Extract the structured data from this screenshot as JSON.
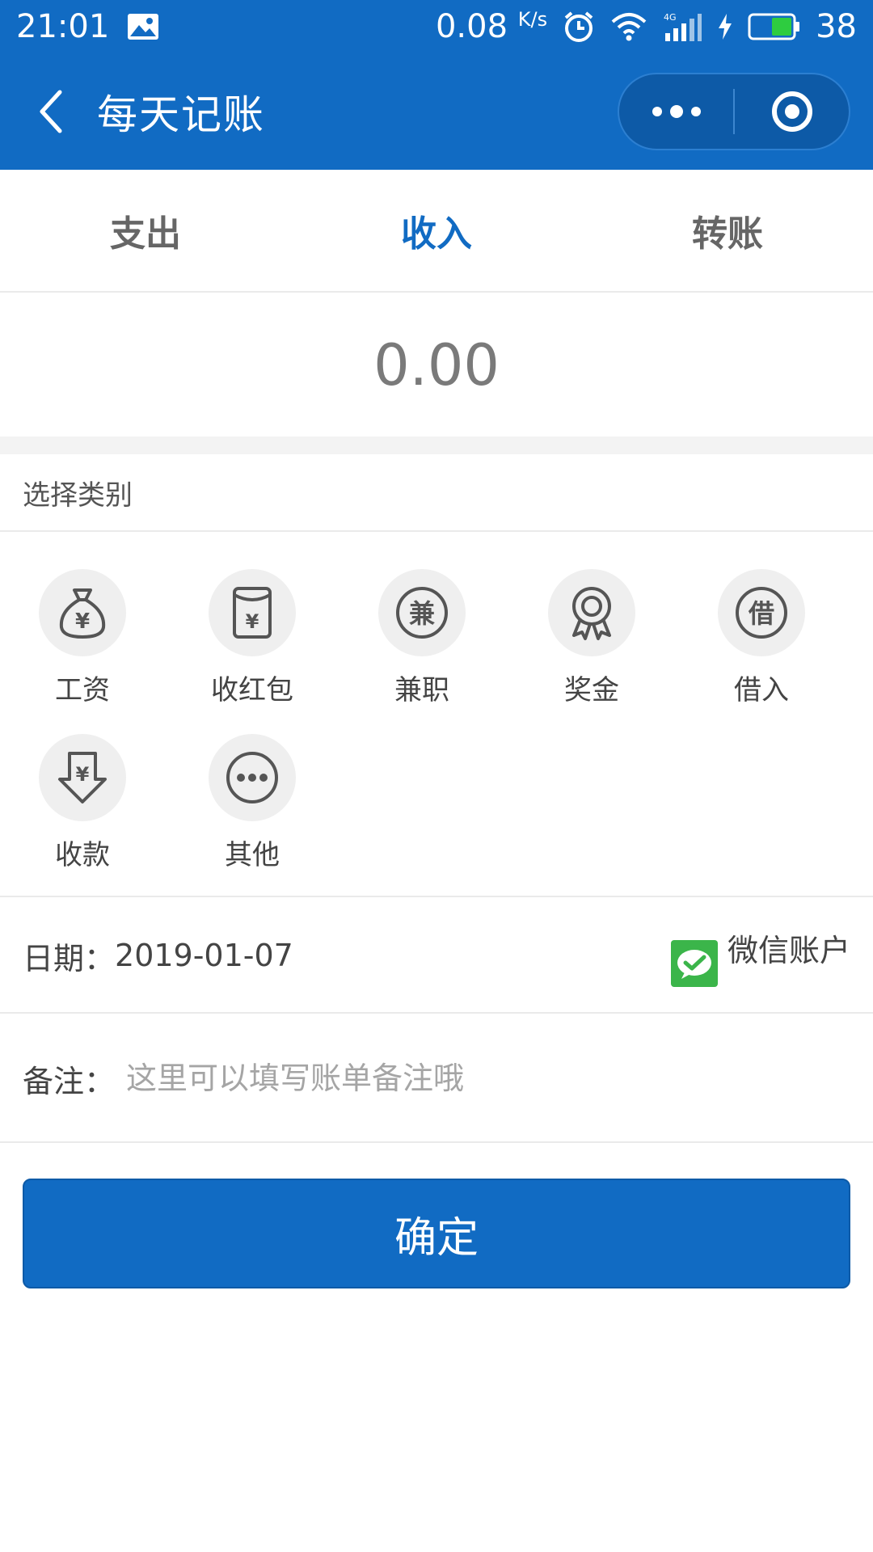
{
  "status_bar": {
    "time": "21:01",
    "net_speed": "0.08",
    "net_unit": "K/s",
    "battery": "38"
  },
  "nav": {
    "title": "每天记账"
  },
  "tabs": [
    {
      "label": "支出",
      "active": false
    },
    {
      "label": "收入",
      "active": true
    },
    {
      "label": "转账",
      "active": false
    }
  ],
  "amount": "0.00",
  "category": {
    "header": "选择类别",
    "items": [
      {
        "label": "工资",
        "icon": "money-bag-icon"
      },
      {
        "label": "收红包",
        "icon": "red-envelope-icon"
      },
      {
        "label": "兼职",
        "icon": "part-time-icon"
      },
      {
        "label": "奖金",
        "icon": "medal-icon"
      },
      {
        "label": "借入",
        "icon": "borrow-icon"
      },
      {
        "label": "收款",
        "icon": "receive-payment-icon"
      },
      {
        "label": "其他",
        "icon": "more-icon"
      }
    ]
  },
  "date": {
    "label": "日期：",
    "value": "2019-01-07"
  },
  "account": {
    "label": "微信账户",
    "icon": "wechat-icon"
  },
  "note": {
    "label": "备注：",
    "value": "",
    "placeholder": "这里可以填写账单备注哦"
  },
  "confirm_label": "确定",
  "colors": {
    "primary": "#116bc3",
    "wechat": "#3bb54a"
  }
}
